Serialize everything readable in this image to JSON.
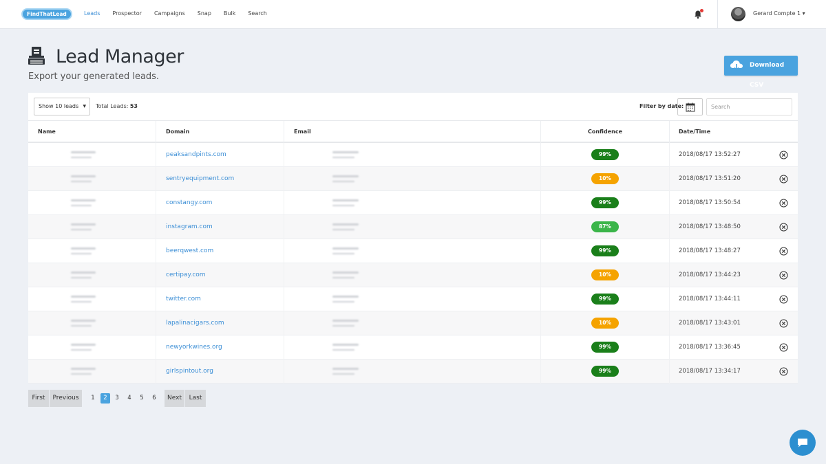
{
  "nav": {
    "logo": "FindThatLead",
    "links": [
      "Leads",
      "Prospector",
      "Campaigns",
      "Snap",
      "Bulk",
      "Search"
    ],
    "active": "Leads",
    "username": "Gerard Compte 1 ▾"
  },
  "header": {
    "title": "Lead Manager",
    "subtitle": "Export your generated leads.",
    "download_label": "Download CSV"
  },
  "toolbar": {
    "show_label": "Show 10 leads",
    "total_label": "Total Leads:",
    "total_value": "53",
    "filter_label": "Filter by date:",
    "search_placeholder": "Search"
  },
  "table": {
    "columns": [
      "Name",
      "Domain",
      "Email",
      "Confidence",
      "Date/Time"
    ],
    "rows": [
      {
        "domain": "peaksandpints.com",
        "confidence": "99%",
        "level": "high",
        "datetime": "2018/08/17 13:52:27"
      },
      {
        "domain": "sentryequipment.com",
        "confidence": "10%",
        "level": "low",
        "datetime": "2018/08/17 13:51:20"
      },
      {
        "domain": "constangy.com",
        "confidence": "99%",
        "level": "high",
        "datetime": "2018/08/17 13:50:54"
      },
      {
        "domain": "instagram.com",
        "confidence": "87%",
        "level": "mid",
        "datetime": "2018/08/17 13:48:50"
      },
      {
        "domain": "beerqwest.com",
        "confidence": "99%",
        "level": "high",
        "datetime": "2018/08/17 13:48:27"
      },
      {
        "domain": "certipay.com",
        "confidence": "10%",
        "level": "low",
        "datetime": "2018/08/17 13:44:23"
      },
      {
        "domain": "twitter.com",
        "confidence": "99%",
        "level": "high",
        "datetime": "2018/08/17 13:44:11"
      },
      {
        "domain": "lapalinacigars.com",
        "confidence": "10%",
        "level": "low",
        "datetime": "2018/08/17 13:43:01"
      },
      {
        "domain": "newyorkwines.org",
        "confidence": "99%",
        "level": "high",
        "datetime": "2018/08/17 13:36:45"
      },
      {
        "domain": "girlspintout.org",
        "confidence": "99%",
        "level": "high",
        "datetime": "2018/08/17 13:34:17"
      }
    ]
  },
  "pagination": {
    "first": "First",
    "previous": "Previous",
    "pages": [
      "1",
      "2",
      "3",
      "4",
      "5",
      "6"
    ],
    "current": "2",
    "next": "Next",
    "last": "Last"
  },
  "colors": {
    "accent": "#4aa3df",
    "link": "#3d8fd6",
    "high": "#1a7f1a",
    "mid": "#3bb54a",
    "low": "#f5a300"
  },
  "icons": [
    "bell-icon",
    "avatar",
    "lead-manager-icon",
    "cloud-download-icon",
    "calendar-icon",
    "close-circle-icon",
    "chat-icon"
  ]
}
